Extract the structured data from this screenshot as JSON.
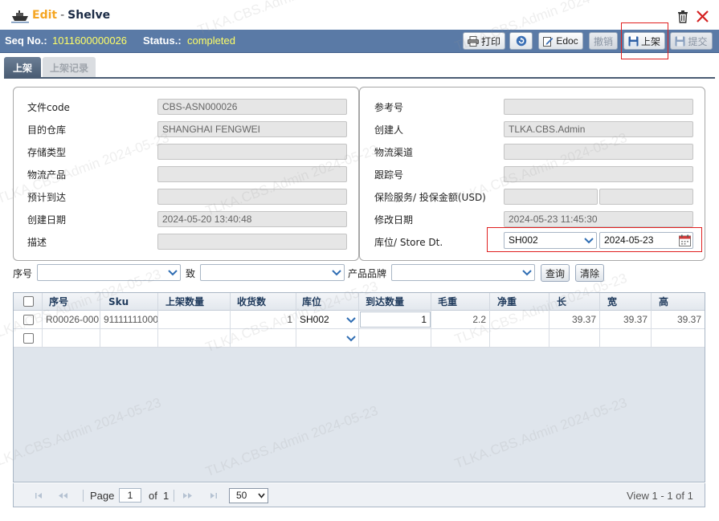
{
  "window": {
    "title_mode": "Edit",
    "title_separator": "-",
    "title_name": "Shelve"
  },
  "infobar": {
    "seq_label": "Seq No.:",
    "seq_value": "1011600000026",
    "status_label": "Status.:",
    "status_value": "completed"
  },
  "toolbar": {
    "print_label": "打印",
    "edoc_label": "Edoc",
    "revoke_label": "撤销",
    "shelve_label": "上架",
    "submit_label": "提交"
  },
  "tabs": [
    {
      "label": "上架",
      "active": true
    },
    {
      "label": "上架记录",
      "active": false
    }
  ],
  "form_left": [
    {
      "label": "文件code",
      "value": "CBS-ASN000026"
    },
    {
      "label": "目的仓库",
      "value": "SHANGHAI FENGWEI"
    },
    {
      "label": "存储类型",
      "value": ""
    },
    {
      "label": "物流产品",
      "value": ""
    },
    {
      "label": "预计到达",
      "value": ""
    },
    {
      "label": "创建日期",
      "value": "2024-05-20 13:40:48"
    },
    {
      "label": "描述",
      "value": ""
    }
  ],
  "form_right": [
    {
      "label": "参考号",
      "value": ""
    },
    {
      "label": "创建人",
      "value": "TLKA.CBS.Admin"
    },
    {
      "label": "物流渠道",
      "value": ""
    },
    {
      "label": "跟踪号",
      "value": ""
    },
    {
      "label": "保险服务/ 投保金额(USD)",
      "value": "",
      "value2": ""
    },
    {
      "label": "修改日期",
      "value": "2024-05-23 11:45:30"
    }
  ],
  "store": {
    "label": "库位/ Store Dt.",
    "location": "SH002",
    "date": "2024-05-23"
  },
  "filter": {
    "seq_label": "序号",
    "to_label": "致",
    "brand_label": "产品品牌",
    "seq_value": "",
    "to_value": "",
    "brand_value": "",
    "query_label": "查询",
    "clear_label": "清除"
  },
  "grid": {
    "columns": [
      "序号",
      "Sku",
      "上架数量",
      "收货数",
      "库位",
      "到达数量",
      "毛重",
      "净重",
      "长",
      "宽",
      "高"
    ],
    "rows": [
      {
        "seq": "R00026-000",
        "sku": "91111111000",
        "shelve_qty": "",
        "received": "1",
        "location": "SH002",
        "arrival_qty": "1",
        "gross": "2.2",
        "net": "",
        "length": "39.37",
        "width": "39.37",
        "height": "39.37"
      },
      {
        "seq": "",
        "sku": "",
        "shelve_qty": "",
        "received": "",
        "location": "",
        "arrival_qty": "",
        "gross": "",
        "net": "",
        "length": "",
        "width": "",
        "height": ""
      }
    ]
  },
  "pager": {
    "page_label": "Page",
    "page_value": "1",
    "of_label": "of",
    "total_pages": "1",
    "page_size": "50",
    "view_text": "View 1 - 1 of 1"
  },
  "watermark": {
    "text": "TLKA.CBS.Admin 2024-05-23"
  },
  "colors": {
    "infobar": "#5a7aa6",
    "status_value": "#ffff66",
    "title_mode": "#f5a623",
    "highlight_box": "#e02020"
  }
}
